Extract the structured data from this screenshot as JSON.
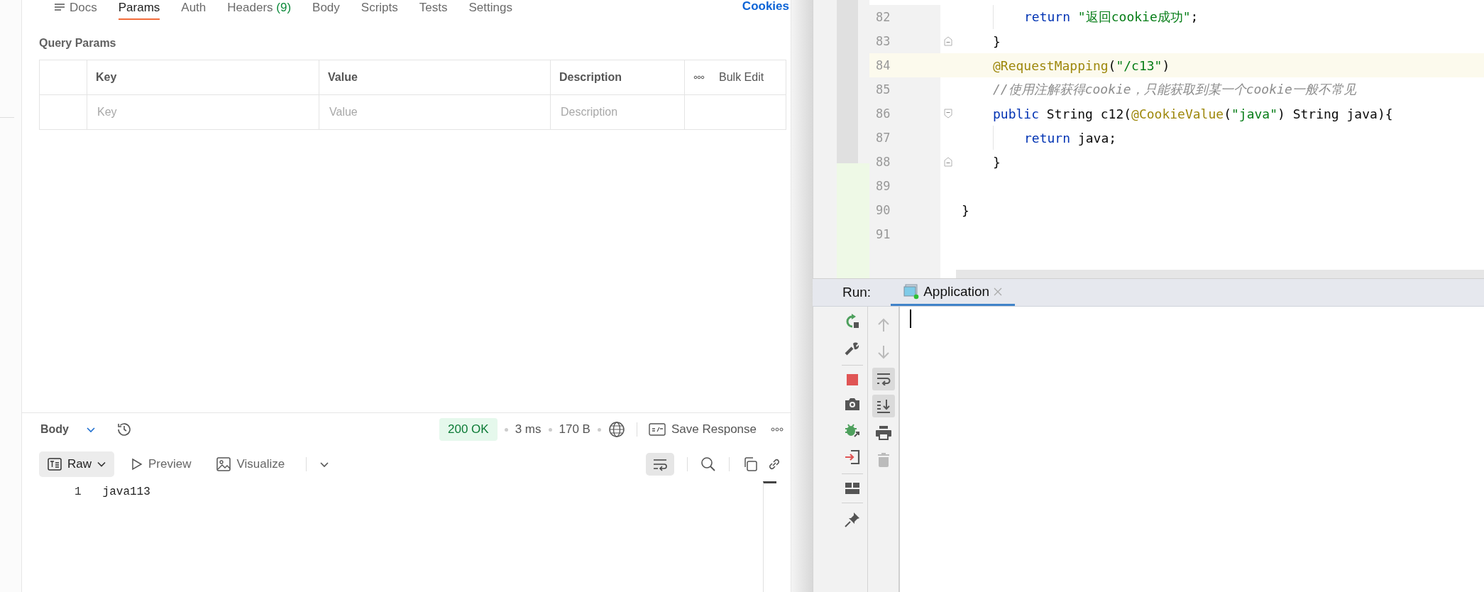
{
  "request_tabs": [
    {
      "label": "Docs",
      "selected": false,
      "kind": "docs"
    },
    {
      "label": "Params",
      "selected": true
    },
    {
      "label": "Auth",
      "selected": false
    },
    {
      "label": "Headers",
      "count": "(9)",
      "selected": false
    },
    {
      "label": "Body",
      "selected": false
    },
    {
      "label": "Scripts",
      "selected": false
    },
    {
      "label": "Tests",
      "selected": false
    },
    {
      "label": "Settings",
      "selected": false
    }
  ],
  "cookies_link": "Cookies",
  "query_params": {
    "title": "Query Params",
    "columns": [
      "Key",
      "Value",
      "Description"
    ],
    "bulk_edit": "Bulk Edit",
    "placeholders": [
      "Key",
      "Value",
      "Description"
    ]
  },
  "response": {
    "body_label": "Body",
    "status": "200 OK",
    "time": "3 ms",
    "size": "170 B",
    "save": "Save Response",
    "format": "Raw",
    "views": [
      "Preview",
      "Visualize"
    ],
    "wrap_lines": true,
    "lines": [
      {
        "number": "1",
        "text": "java113"
      }
    ]
  },
  "editor": {
    "lines": [
      {
        "number": "82",
        "kind": "body",
        "current": false,
        "fold_start": false,
        "fold_end": false,
        "tokens": [
          {
            "kind": "keyword",
            "text": "return"
          },
          {
            "kind": "string",
            "text": " \"返回cookie成功\""
          },
          {
            "kind": "plain",
            "text": ";"
          }
        ]
      },
      {
        "number": "83",
        "kind": "member",
        "current": false,
        "fold_start": false,
        "fold_end": true,
        "tokens": [
          {
            "kind": "plain",
            "text": "}"
          }
        ]
      },
      {
        "number": "84",
        "kind": "member",
        "current": true,
        "fold_start": false,
        "fold_end": false,
        "tokens": [
          {
            "kind": "annotation",
            "text": "@RequestMapping"
          },
          {
            "kind": "plain",
            "text": "("
          },
          {
            "kind": "string",
            "text": "\"/c13\""
          },
          {
            "kind": "plain",
            "text": ")"
          }
        ]
      },
      {
        "number": "85",
        "kind": "member",
        "current": false,
        "fold_start": false,
        "fold_end": false,
        "tokens": [
          {
            "kind": "comment",
            "text": "//使用注解获得cookie，只能获取到某一个cookie一般不常见"
          }
        ]
      },
      {
        "number": "86",
        "kind": "member",
        "current": false,
        "fold_start": true,
        "fold_end": false,
        "tokens": [
          {
            "kind": "keyword",
            "text": "public"
          },
          {
            "kind": "plain",
            "text": " String c12("
          },
          {
            "kind": "annotation",
            "text": "@CookieValue"
          },
          {
            "kind": "plain",
            "text": "("
          },
          {
            "kind": "string",
            "text": "\"java\""
          },
          {
            "kind": "plain",
            "text": ") String java){"
          }
        ]
      },
      {
        "number": "87",
        "kind": "body",
        "current": false,
        "fold_start": false,
        "fold_end": false,
        "tokens": [
          {
            "kind": "keyword",
            "text": "return"
          },
          {
            "kind": "plain",
            "text": " java;"
          }
        ]
      },
      {
        "number": "88",
        "kind": "member",
        "current": false,
        "fold_start": false,
        "fold_end": true,
        "tokens": [
          {
            "kind": "plain",
            "text": "}"
          }
        ]
      },
      {
        "number": "89",
        "kind": "top",
        "current": false,
        "fold_start": false,
        "fold_end": false
      },
      {
        "number": "90",
        "kind": "top",
        "current": false,
        "fold_start": false,
        "fold_end": false,
        "tokens": [
          {
            "kind": "plain",
            "text": "}"
          }
        ]
      },
      {
        "number": "91",
        "kind": "top",
        "current": false,
        "fold_start": false,
        "fold_end": false
      }
    ]
  },
  "run": {
    "label": "Run:",
    "tab": {
      "label": "Application",
      "selected": true
    },
    "left_tools": [
      {
        "kind": "rerun"
      },
      {
        "kind": "wrench"
      },
      {
        "kind": "separator"
      },
      {
        "kind": "stop"
      },
      {
        "kind": "camera"
      },
      {
        "kind": "bug"
      },
      {
        "kind": "login"
      },
      {
        "kind": "separator"
      },
      {
        "kind": "layout"
      },
      {
        "kind": "separator"
      },
      {
        "kind": "pin"
      }
    ],
    "right_tools": [
      {
        "kind": "up",
        "disabled": true,
        "on": false
      },
      {
        "kind": "down",
        "disabled": true,
        "on": false
      },
      {
        "kind": "wrap",
        "disabled": false,
        "on": true
      },
      {
        "kind": "scroll-end",
        "disabled": false,
        "on": true
      },
      {
        "kind": "print",
        "disabled": false,
        "on": false
      },
      {
        "kind": "trash",
        "disabled": true,
        "on": false
      }
    ]
  }
}
